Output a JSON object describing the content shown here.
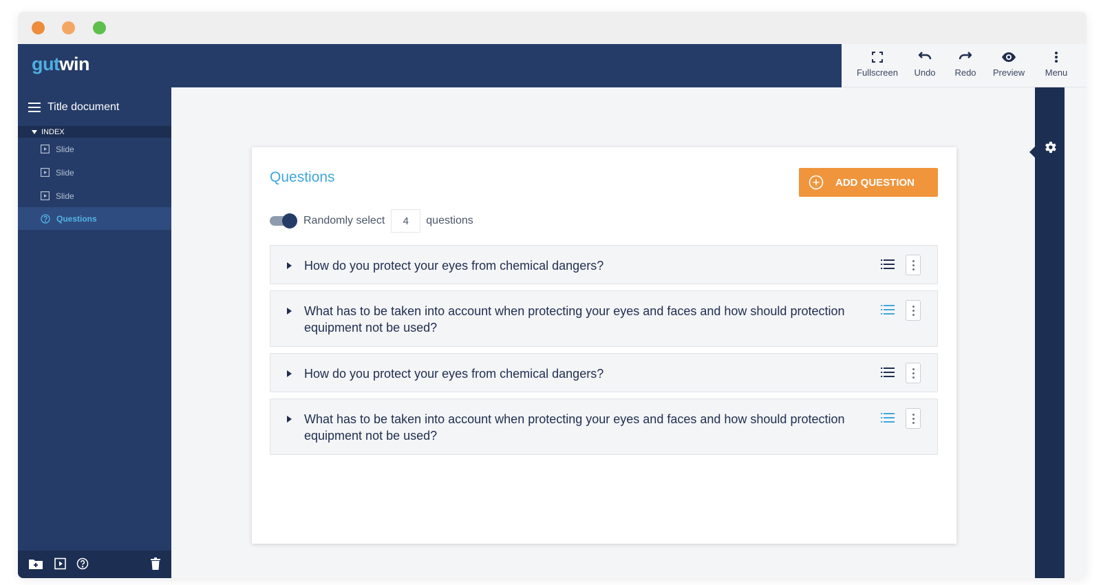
{
  "window": {
    "dots": [
      "#ed8c3a",
      "#f2a862",
      "#5fbf4d"
    ]
  },
  "brand": {
    "part1": "gut",
    "part2": "win"
  },
  "toolbar": {
    "items": [
      {
        "label": "Fullscreen",
        "icon": "fullscreen-icon"
      },
      {
        "label": "Undo",
        "icon": "undo-icon"
      },
      {
        "label": "Redo",
        "icon": "redo-icon"
      },
      {
        "label": "Preview",
        "icon": "eye-icon"
      },
      {
        "label": "Menu",
        "icon": "vertical-dots-icon"
      }
    ]
  },
  "sidebar": {
    "title": "Title document",
    "index_label": "INDEX",
    "items": [
      {
        "label": "Slide",
        "icon": "slide-icon"
      },
      {
        "label": "Slide",
        "icon": "slide-icon"
      },
      {
        "label": "Slide",
        "icon": "slide-icon"
      },
      {
        "label": "Questions",
        "icon": "question-circle-icon",
        "active": true
      }
    ],
    "footer_icons": [
      "add-folder-icon",
      "add-slide-icon",
      "add-question-icon",
      "trash-icon"
    ]
  },
  "main": {
    "title": "Questions",
    "add_button": "ADD QUESTION",
    "random_select": {
      "enabled": true,
      "prefix": "Randomly select",
      "count": "4",
      "suffix": "questions"
    },
    "questions": [
      {
        "text": "How do you protect your eyes from chemical dangers?",
        "list_icon_active": false
      },
      {
        "text": "What has to be taken into account when protecting your eyes and faces and how should protection equipment not be used?",
        "list_icon_active": true
      },
      {
        "text": "How do you protect your eyes from chemical dangers?",
        "list_icon_active": false
      },
      {
        "text": "What has to be taken into account when protecting your eyes and faces and how should protection equipment not be used?",
        "list_icon_active": true
      }
    ]
  },
  "colors": {
    "navy": "#253c68",
    "navy_dark": "#1c2e52",
    "accent_blue": "#3fa6dc",
    "orange": "#f0953c",
    "list_icon_dark": "#1f2d4e",
    "list_icon_blue": "#3fa6dc"
  }
}
